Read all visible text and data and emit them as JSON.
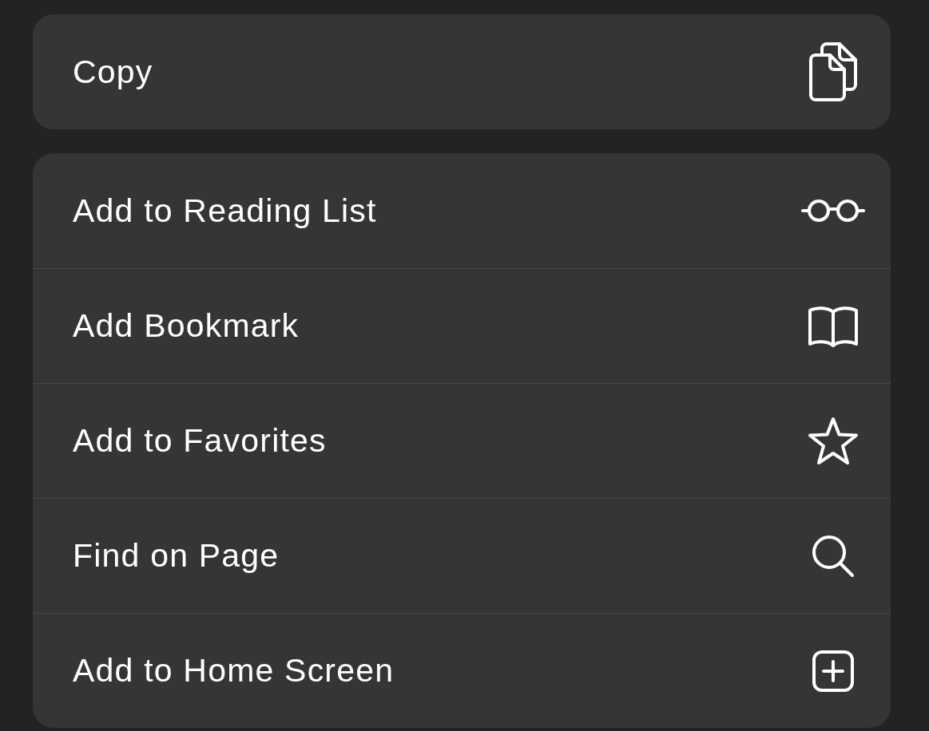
{
  "menu_groups": [
    {
      "items": [
        {
          "label": "Copy"
        }
      ]
    },
    {
      "items": [
        {
          "label": "Add to Reading List"
        },
        {
          "label": "Add Bookmark"
        },
        {
          "label": "Add to Favorites"
        },
        {
          "label": "Find on Page"
        },
        {
          "label": "Add to Home Screen"
        }
      ]
    }
  ]
}
